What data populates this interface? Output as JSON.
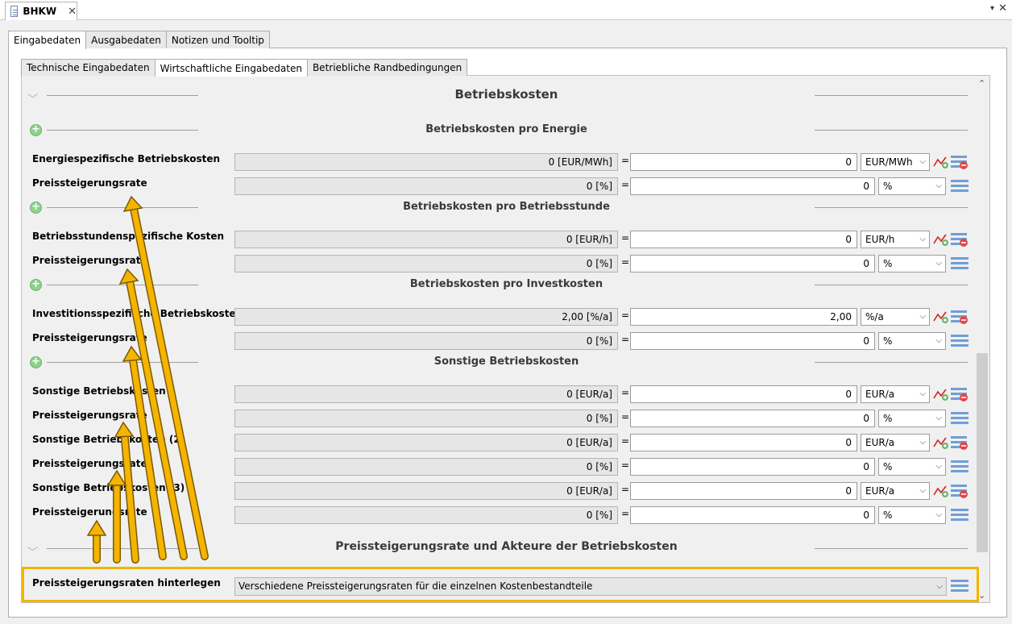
{
  "editor": {
    "tab_title": "BHKW",
    "close_glyph": "✕",
    "menu_glyph": "▾",
    "view_close_glyph": "✕"
  },
  "outer_tabs": [
    "Eingabedaten",
    "Ausgabedaten",
    "Notizen und Tooltip"
  ],
  "inner_tabs": [
    "Technische Eingabedaten",
    "Wirtschaftliche Eingabedaten",
    "Betriebliche Randbedingungen"
  ],
  "main_section": "Betriebskosten",
  "sections": {
    "energie": "Betriebskosten pro Energie",
    "stunde": "Betriebskosten pro Betriebsstunde",
    "invest": "Betriebskosten pro Investkosten",
    "sonstige": "Sonstige Betriebskosten"
  },
  "rows": [
    {
      "label": "Energiespezifische Betriebskosten",
      "display": "0 [EUR/MWh]",
      "value": "0",
      "unit": "EUR/MWh"
    },
    {
      "label": "Preissteigerungsrate",
      "display": "0 [%]",
      "value": "0",
      "unit": "%"
    },
    {
      "label": "Betriebsstundenspezifische Kosten",
      "display": "0 [EUR/h]",
      "value": "0",
      "unit": "EUR/h"
    },
    {
      "label": "Preissteigerungsrate",
      "display": "0 [%]",
      "value": "0",
      "unit": "%"
    },
    {
      "label": "Investitionsspezifische Betriebskosten",
      "display": "2,00 [%/a]",
      "value": "2,00",
      "unit": "%/a"
    },
    {
      "label": "Preissteigerungsrate",
      "display": "0 [%]",
      "value": "0",
      "unit": "%"
    },
    {
      "label": "Sonstige Betriebskosten",
      "display": "0 [EUR/a]",
      "value": "0",
      "unit": "EUR/a"
    },
    {
      "label": "Preissteigerungsrate",
      "display": "0 [%]",
      "value": "0",
      "unit": "%"
    },
    {
      "label": "Sonstige Betriebskosten (2)",
      "display": "0 [EUR/a]",
      "value": "0",
      "unit": "EUR/a"
    },
    {
      "label": "Preissteigerungsrate",
      "display": "0 [%]",
      "value": "0",
      "unit": "%"
    },
    {
      "label": "Sonstige Betriebskosten (3)",
      "display": "0 [EUR/a]",
      "value": "0",
      "unit": "EUR/a"
    },
    {
      "label": "Preissteigerungsrate",
      "display": "0 [%]",
      "value": "0",
      "unit": "%"
    }
  ],
  "equals_sign": "=",
  "dropdown_glyph": "⌵",
  "chevron_glyph": "⌵",
  "plus_glyph": "+",
  "bottom_section": "Preissteigerungsrate und Akteure der Betriebskosten",
  "bottom_row": {
    "label": "Preissteigerungsraten hinterlegen",
    "selected": "Verschiedene Preissteigerungsraten für die einzelnen Kostenbestandteile"
  },
  "scroll": {
    "up": "⌃",
    "down": "⌄"
  },
  "colors": {
    "annotation": "#f5b400",
    "annotation_outline": "#7a5a00",
    "trend_red": "#d62020",
    "remove_red": "#e04848",
    "stack_blue": "#6f9fd6"
  }
}
